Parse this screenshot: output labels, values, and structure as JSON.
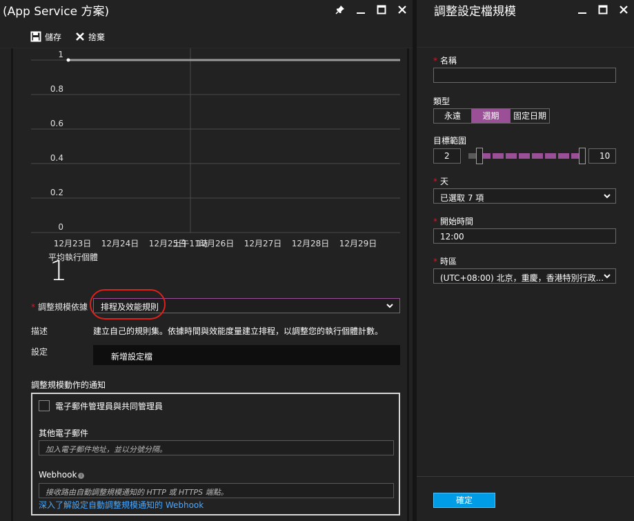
{
  "left_blade": {
    "title": "(App Service 方案)",
    "toolbar": {
      "save_label": "儲存",
      "discard_label": "捨棄"
    },
    "chart_data": {
      "type": "line",
      "title": "",
      "xlabel": "",
      "ylabel": "",
      "y_ticks": [
        "1",
        "0.8",
        "0.6",
        "0.4",
        "0.2",
        "0"
      ],
      "ylim": [
        0,
        1
      ],
      "categories": [
        "12月23日",
        "12月24日",
        "12月25日",
        "12月26日",
        "12月27日",
        "12月28日",
        "12月29日"
      ],
      "marker_label": "上午11時",
      "series": [
        {
          "values": [
            1,
            1,
            1,
            1,
            1,
            1,
            1
          ]
        }
      ],
      "grid": true
    },
    "avg_label": "平均執行個體",
    "avg_value": "1",
    "scale_by": {
      "label": "調整規模依據",
      "value": "排程及效能規則"
    },
    "description": {
      "label": "描述",
      "text": "建立自己的規則集。依據時間與效能度量建立排程，以調整您的執行個體計數。"
    },
    "settings": {
      "label": "設定",
      "add_profile": "新增設定檔"
    },
    "notifications": {
      "header": "調整規模動作的通知",
      "admins_checkbox": "電子郵件管理員與共同管理員",
      "other_emails_label": "其他電子郵件",
      "other_emails_placeholder": "加入電子郵件地址，並以分號分隔。",
      "webhook_label": "Webhook",
      "webhook_placeholder": "接收路由自動調整規模通知的 HTTP 或 HTTPS 端點。",
      "webhook_link": "深入了解設定自動調整規模通知的 Webhook"
    }
  },
  "right_blade": {
    "title": "調整設定檔規模",
    "name": {
      "label": "名稱",
      "value": ""
    },
    "type": {
      "label": "類型",
      "options": [
        "永遠",
        "週期",
        "固定日期"
      ],
      "selected": "週期"
    },
    "target_range": {
      "label": "目標範圍",
      "min": "2",
      "max": "10"
    },
    "days": {
      "label": "天",
      "value": "已選取 7 項"
    },
    "start_time": {
      "label": "開始時間",
      "value": "12:00"
    },
    "timezone": {
      "label": "時區",
      "value": "(UTC+08:00) 北京，重慶，香港特別行政..."
    },
    "ok_label": "確定"
  },
  "colors": {
    "accent": "#9b4f96",
    "required": "#e81123",
    "ok_button": "#009ce5",
    "link": "#4aa9ff"
  }
}
